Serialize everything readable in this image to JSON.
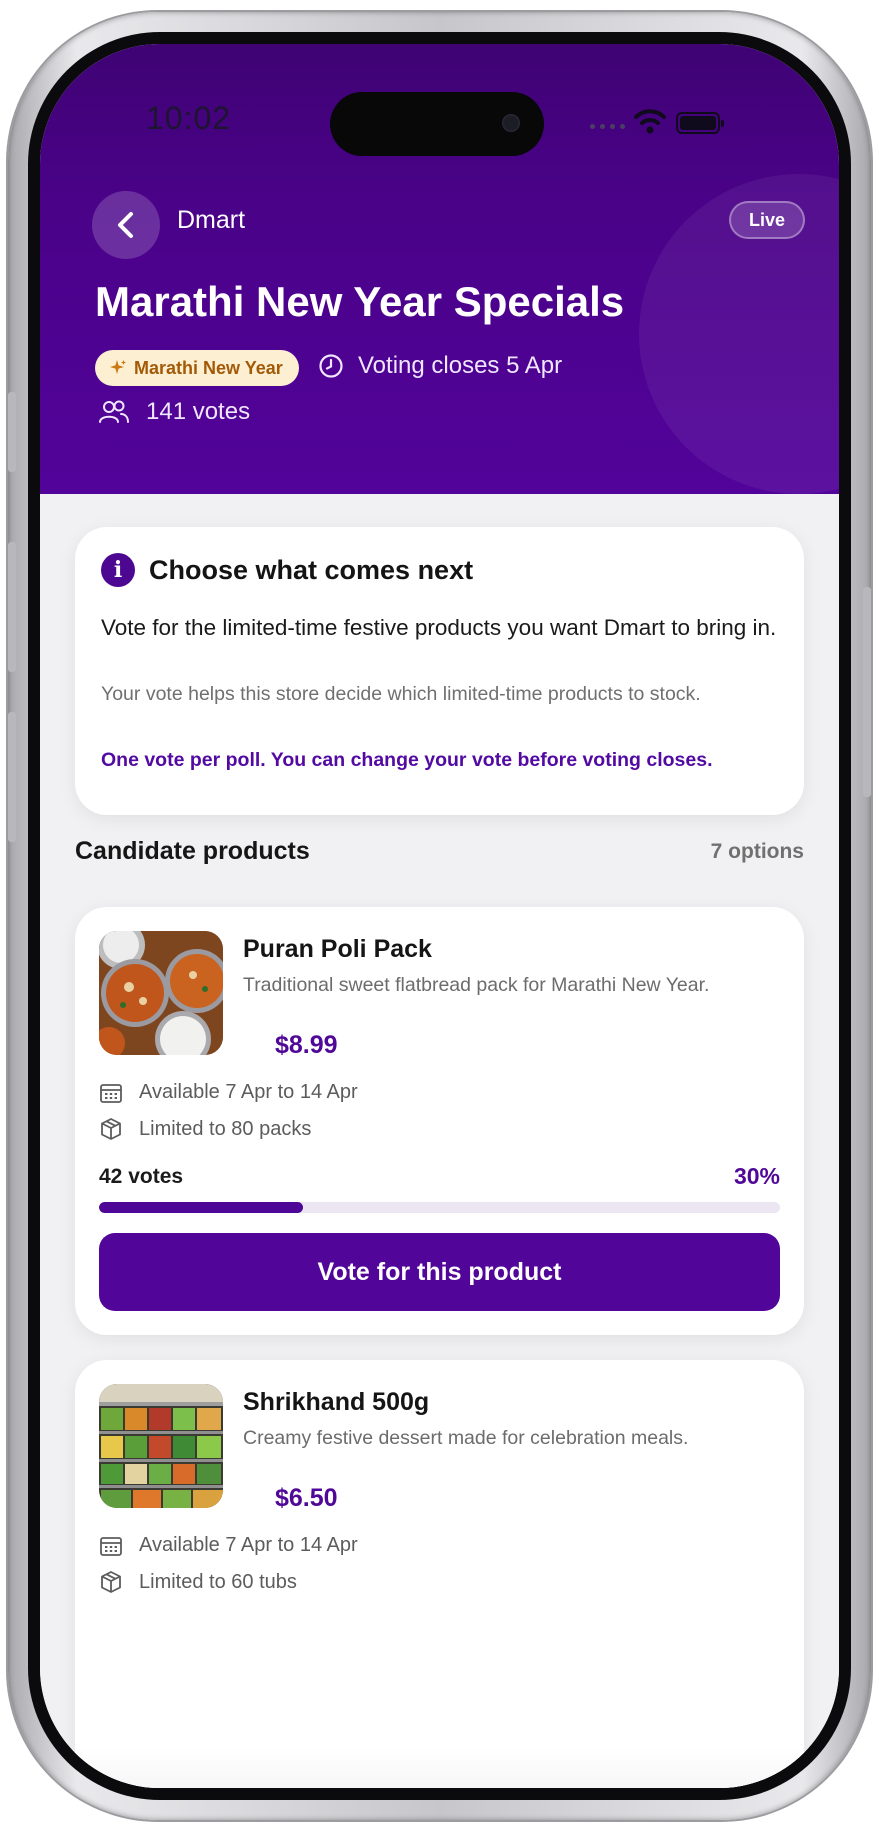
{
  "status_bar": {
    "time": "10:02"
  },
  "header": {
    "store_name": "Dmart",
    "live_label": "Live",
    "poll_title": "Marathi New Year Specials",
    "festival_tag": "Marathi New Year",
    "closes_text": "Voting closes 5 Apr",
    "votes_text": "141 votes"
  },
  "info_card": {
    "title": "Choose what comes next",
    "body": "Vote for the limited-time festive products you want Dmart to bring in.",
    "sub": "Your vote helps this store decide which limited-time products to stock.",
    "note": "One vote per poll. You can change your vote before voting closes."
  },
  "section": {
    "title": "Candidate products",
    "count": "7 options"
  },
  "products": [
    {
      "name": "Puran Poli Pack",
      "description": "Traditional sweet flatbread pack for Marathi New Year.",
      "price": "$8.99",
      "availability": "Available 7 Apr to 14 Apr",
      "limit": "Limited to 80 packs",
      "votes": "42 votes",
      "percent": "30%",
      "progress_fraction": 0.3,
      "vote_button": "Vote for this product"
    },
    {
      "name": "Shrikhand 500g",
      "description": "Creamy festive dessert made for celebration meals.",
      "price": "$6.50",
      "availability": "Available 7 Apr to 14 Apr",
      "limit": "Limited to 60 tubs"
    }
  ],
  "colors": {
    "brand_purple": "#520599",
    "header_purple": "#4a0288",
    "festival_chip_bg": "#fdf0d2",
    "festival_chip_text": "#a35a08"
  }
}
